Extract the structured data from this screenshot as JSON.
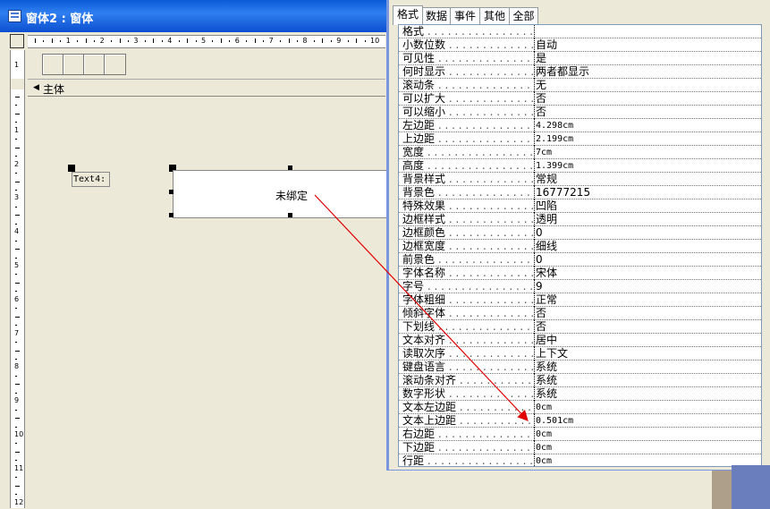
{
  "window": {
    "title": "窗体2 : 窗体",
    "section_header": "主体",
    "ruler_marks": [
      "1",
      "2",
      "3",
      "4",
      "5",
      "6",
      "7",
      "8",
      "9",
      "10"
    ],
    "vertical_ruler_top": [
      "1"
    ],
    "vertical_ruler_marks": [
      "1",
      "2",
      "3",
      "4",
      "5",
      "6",
      "7",
      "8",
      "9",
      "10",
      "11",
      "12"
    ]
  },
  "controls": {
    "label_text": "Text4:",
    "textbox_text": "未绑定"
  },
  "property_sheet": {
    "tabs": [
      "格式",
      "数据",
      "事件",
      "其他",
      "全部"
    ],
    "active_tab": "格式",
    "rows": [
      {
        "name": "格式",
        "value": ""
      },
      {
        "name": "小数位数",
        "value": "自动"
      },
      {
        "name": "可见性",
        "value": "是"
      },
      {
        "name": "何时显示",
        "value": "两者都显示"
      },
      {
        "name": "滚动条",
        "value": "无"
      },
      {
        "name": "可以扩大",
        "value": "否"
      },
      {
        "name": "可以缩小",
        "value": "否"
      },
      {
        "name": "左边距",
        "value": "4.298cm"
      },
      {
        "name": "上边距",
        "value": "2.199cm"
      },
      {
        "name": "宽度",
        "value": "7cm"
      },
      {
        "name": "高度",
        "value": "1.399cm"
      },
      {
        "name": "背景样式",
        "value": "常规"
      },
      {
        "name": "背景色",
        "value": "16777215"
      },
      {
        "name": "特殊效果",
        "value": "凹陷"
      },
      {
        "name": "边框样式",
        "value": "透明"
      },
      {
        "name": "边框颜色",
        "value": "0"
      },
      {
        "name": "边框宽度",
        "value": "细线"
      },
      {
        "name": "前景色",
        "value": "0"
      },
      {
        "name": "字体名称",
        "value": "宋体"
      },
      {
        "name": "字号",
        "value": "9"
      },
      {
        "name": "字体粗细",
        "value": "正常"
      },
      {
        "name": "倾斜字体",
        "value": "否"
      },
      {
        "name": "下划线",
        "value": "否"
      },
      {
        "name": "文本对齐",
        "value": "居中"
      },
      {
        "name": "读取次序",
        "value": "上下文"
      },
      {
        "name": "键盘语言",
        "value": "系统"
      },
      {
        "name": "滚动条对齐",
        "value": "系统"
      },
      {
        "name": "数字形状",
        "value": "系统"
      },
      {
        "name": "文本左边距",
        "value": "0cm"
      },
      {
        "name": "文本上边距",
        "value": "0.501cm"
      },
      {
        "name": "右边距",
        "value": "0cm"
      },
      {
        "name": "下边距",
        "value": "0cm"
      },
      {
        "name": "行距",
        "value": "0cm"
      }
    ]
  },
  "colors": {
    "titlebar": "#0a5ad8",
    "annotation_arrow": "#e00000",
    "selection_handle": "#000000"
  },
  "icons": {
    "window_icon": "form-icon",
    "section_arrow": "arrow-left-icon",
    "scroll_up": "chevron-up-icon",
    "scroll_down": "chevron-down-icon"
  }
}
